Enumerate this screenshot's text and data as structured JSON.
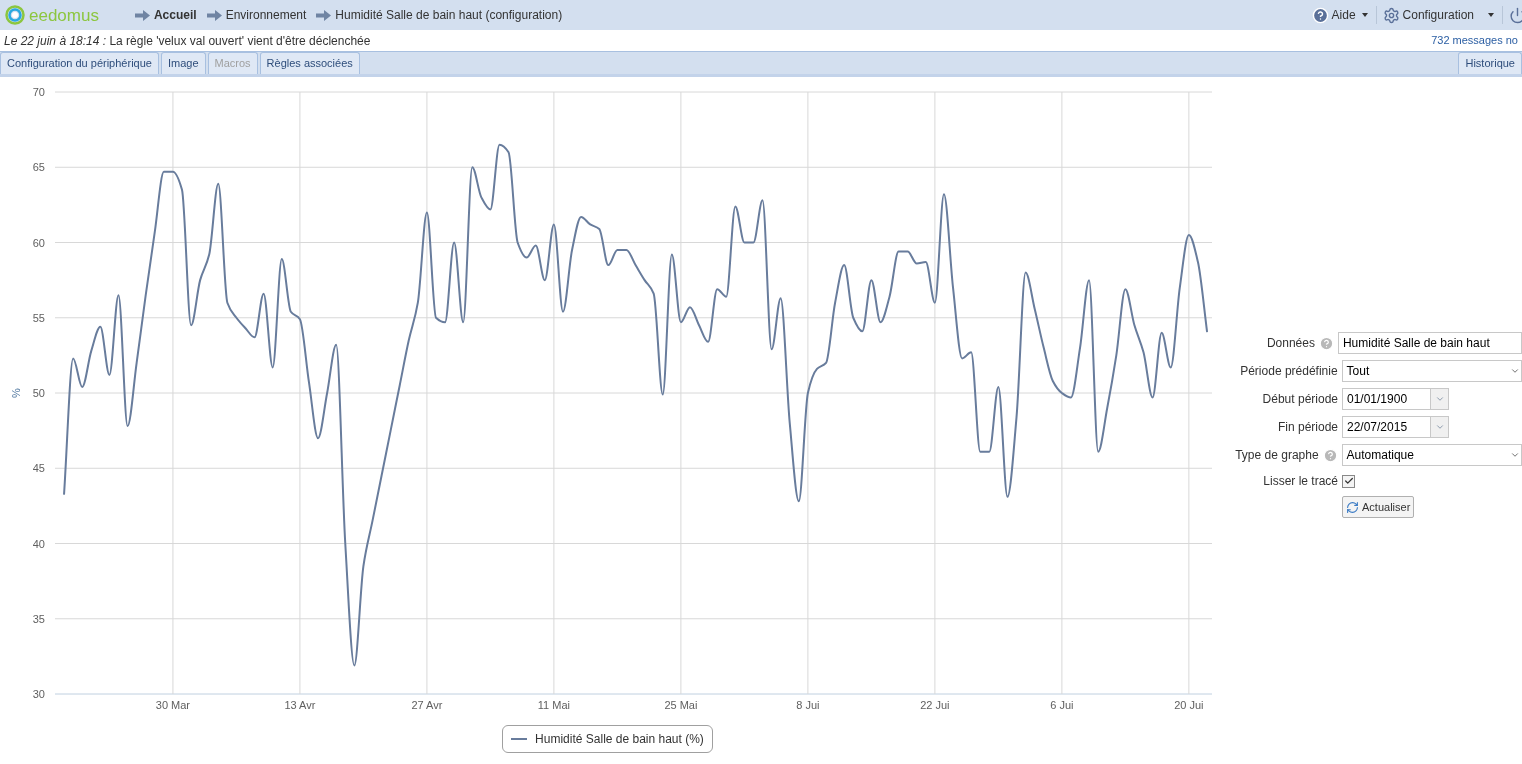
{
  "header": {
    "logo": "eedomus",
    "breadcrumb": [
      {
        "label": "Accueil",
        "emphasized": true
      },
      {
        "label": "Environnement",
        "emphasized": false
      },
      {
        "label": "Humidité Salle de bain haut (configuration)",
        "emphasized": false
      }
    ],
    "menu": [
      {
        "kind": "help",
        "label": "Aide"
      },
      {
        "kind": "settings",
        "label": "Configuration"
      }
    ]
  },
  "notification": {
    "date": "Le 22 juin à 18:14 :",
    "text": "La règle 'velux val ouvert' vient d'être déclenchée",
    "count": "732 messages no"
  },
  "tabs": [
    {
      "label": "Configuration du périphérique",
      "disabled": false
    },
    {
      "label": "Image",
      "disabled": false
    },
    {
      "label": "Macros",
      "disabled": true
    },
    {
      "label": "Règles associées",
      "disabled": false
    }
  ],
  "right_tab": {
    "label": "Historique",
    "disabled": false
  },
  "chart": {
    "chart_data": {
      "type": "line",
      "ylabel": "%",
      "grid": true,
      "ylim": [
        30,
        70
      ],
      "yticks": [
        30,
        35,
        40,
        45,
        50,
        55,
        60,
        65,
        70
      ],
      "categories": [
        null,
        null,
        null,
        null,
        null,
        null,
        null,
        null,
        null,
        null,
        null,
        null,
        "30 Mar",
        null,
        null,
        null,
        null,
        null,
        null,
        null,
        null,
        null,
        null,
        null,
        null,
        null,
        "13 Avr",
        null,
        null,
        null,
        null,
        null,
        null,
        null,
        null,
        null,
        null,
        null,
        null,
        null,
        "27 Avr",
        null,
        null,
        null,
        null,
        null,
        null,
        null,
        null,
        null,
        null,
        null,
        null,
        null,
        "11 Mai",
        null,
        null,
        null,
        null,
        null,
        null,
        null,
        null,
        null,
        null,
        null,
        null,
        null,
        "25 Mai",
        null,
        null,
        null,
        null,
        null,
        null,
        null,
        null,
        null,
        null,
        null,
        null,
        null,
        "8 Jui",
        null,
        null,
        null,
        null,
        null,
        null,
        null,
        null,
        null,
        null,
        null,
        null,
        null,
        "22 Jui",
        null,
        null,
        null,
        null,
        null,
        null,
        null,
        null,
        null,
        null,
        null,
        null,
        null,
        "6 Jui",
        null,
        null,
        null,
        null,
        null,
        null,
        null,
        null,
        null,
        null,
        null,
        null,
        null,
        "20 Jui",
        null,
        null
      ],
      "series": [
        {
          "name": "Humidité Salle de bain haut (%)",
          "color": "#687c9c",
          "values": [
            43.3,
            52.3,
            50.4,
            52.8,
            54.4,
            51.2,
            56.5,
            47.8,
            52,
            56.5,
            60.7,
            64.7,
            64.7,
            63.5,
            54.5,
            57.5,
            59.2,
            63.9,
            56,
            55,
            54.3,
            53.7,
            56.6,
            51.7,
            58.9,
            55.4,
            54.9,
            50.7,
            47,
            50,
            53.2,
            40,
            31.9,
            38.5,
            41.5,
            44.5,
            47.5,
            50.5,
            53.5,
            56,
            62,
            55,
            54.7,
            60,
            54.7,
            65,
            63,
            62.2,
            66.5,
            66,
            60,
            59,
            59.8,
            57.5,
            61.2,
            55.4,
            59.5,
            61.7,
            61.2,
            60.9,
            58.5,
            59.5,
            59.5,
            58.5,
            57.5,
            56.6,
            49.9,
            59.2,
            54.7,
            55.7,
            54.5,
            53.4,
            56.9,
            56.4,
            62.4,
            60,
            60,
            62.8,
            52.9,
            56.3,
            48,
            42.8,
            50,
            51.6,
            52,
            56,
            58.5,
            55,
            54.1,
            57.5,
            54.7,
            56.4,
            59.4,
            59.4,
            58.6,
            58.7,
            56,
            63.2,
            57,
            52.3,
            52.7,
            46.1,
            46.1,
            50.4,
            43.1,
            48.4,
            58,
            55.6,
            53,
            50.8,
            50,
            49.7,
            53,
            57.5,
            46.1,
            49,
            52.5,
            56.9,
            54.5,
            52.7,
            49.7,
            54,
            51.7,
            57,
            60.5,
            58.7,
            54.1
          ]
        }
      ]
    }
  },
  "form": {
    "fields": [
      {
        "kind": "text",
        "label": "Données",
        "help": true,
        "value": "Humidité Salle de bain haut"
      },
      {
        "kind": "select",
        "label": "Période prédéfinie",
        "help": false,
        "value": "Tout"
      },
      {
        "kind": "date",
        "label": "Début période",
        "help": false,
        "value": "01/01/1900"
      },
      {
        "kind": "date",
        "label": "Fin période",
        "help": false,
        "value": "22/07/2015"
      },
      {
        "kind": "select",
        "label": "Type de graphe",
        "help": true,
        "value": "Automatique"
      },
      {
        "kind": "checkbox",
        "label": "Lisser le tracé",
        "help": false,
        "checked": true
      }
    ],
    "button": "Actualiser"
  }
}
